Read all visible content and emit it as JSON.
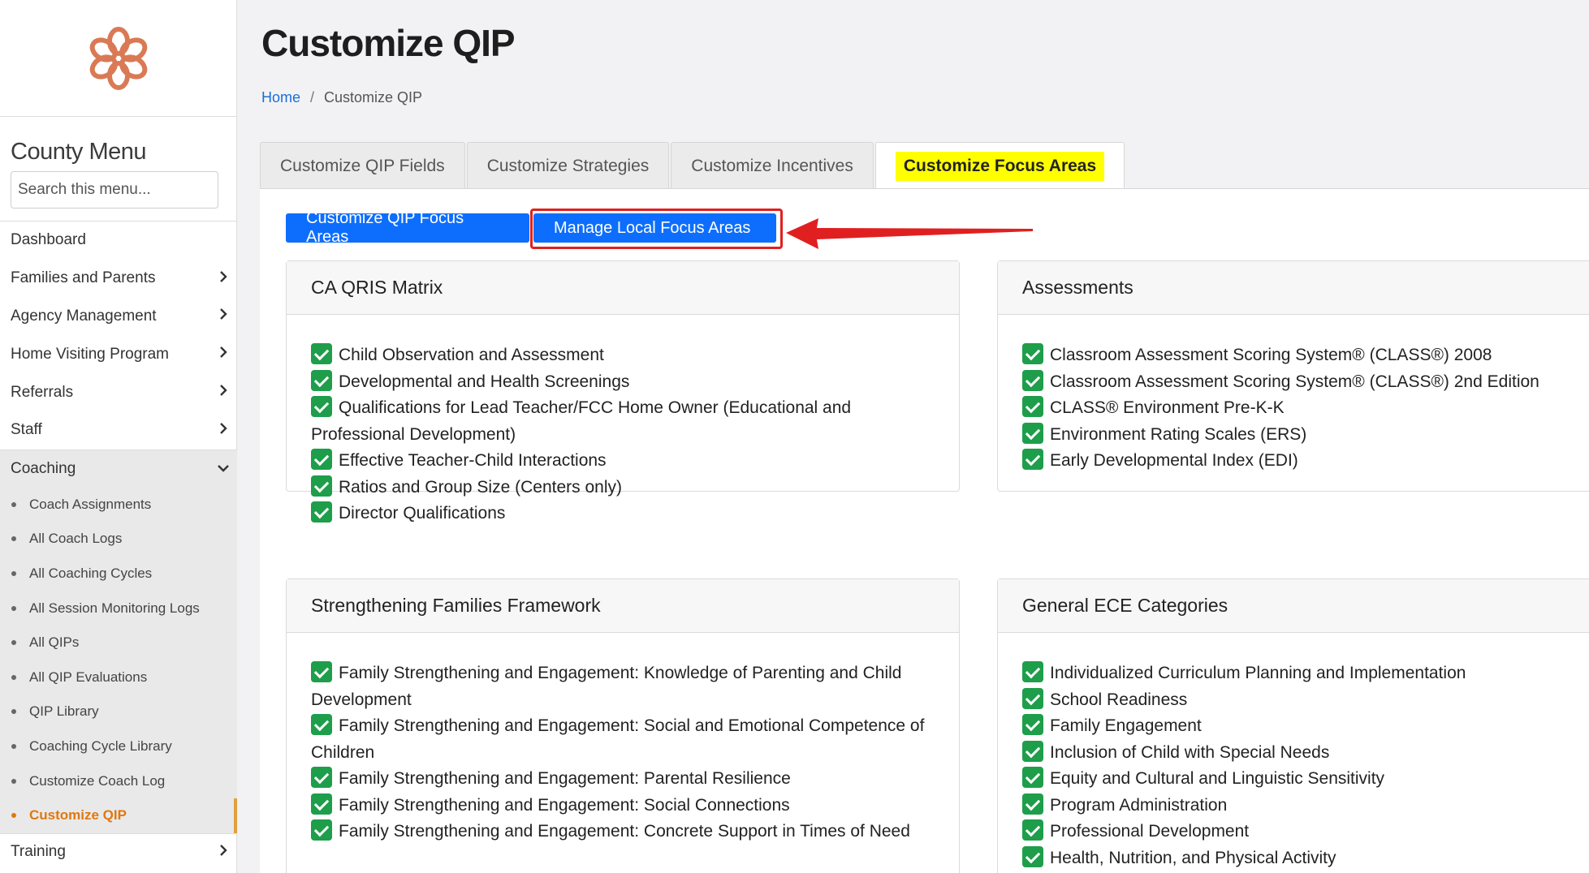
{
  "sidebar": {
    "menu_title": "County Menu",
    "search_placeholder": "Search this menu...",
    "items": [
      {
        "label": "Dashboard",
        "has_chevron": false
      },
      {
        "label": "Families and Parents",
        "has_chevron": true
      },
      {
        "label": "Agency Management",
        "has_chevron": true
      },
      {
        "label": "Home Visiting Program",
        "has_chevron": true
      },
      {
        "label": "Referrals",
        "has_chevron": true
      },
      {
        "label": "Staff",
        "has_chevron": true
      }
    ],
    "coaching": {
      "label": "Coaching",
      "subitems": [
        "Coach Assignments",
        "All Coach Logs",
        "All Coaching Cycles",
        "All Session Monitoring Logs",
        "All QIPs",
        "All QIP Evaluations",
        "QIP Library",
        "Coaching Cycle Library",
        "Customize Coach Log",
        "Customize QIP"
      ],
      "active_subitem": "Customize QIP"
    },
    "training": {
      "label": "Training"
    }
  },
  "header": {
    "title": "Customize QIP",
    "breadcrumb": {
      "home": "Home",
      "separator": "/",
      "current": "Customize QIP"
    }
  },
  "tabs": [
    {
      "label": "Customize QIP Fields",
      "active": false
    },
    {
      "label": "Customize Strategies",
      "active": false
    },
    {
      "label": "Customize Incentives",
      "active": false
    },
    {
      "label": "Customize Focus Areas",
      "active": true
    }
  ],
  "buttons": {
    "qip_focus_areas": "Customize QIP Focus Areas",
    "local_focus_areas": "Manage Local Focus Areas"
  },
  "cards": {
    "qris": {
      "title": "CA QRIS Matrix",
      "items": [
        "Child Observation and Assessment",
        "Developmental and Health Screenings",
        "Qualifications for Lead Teacher/FCC Home Owner (Educational and Professional Development)",
        "Effective Teacher-Child Interactions",
        "Ratios and Group Size (Centers only)",
        "Director Qualifications"
      ]
    },
    "assessments": {
      "title": "Assessments",
      "items": [
        "Classroom Assessment Scoring System® (CLASS®) 2008",
        "Classroom Assessment Scoring System® (CLASS®) 2nd Edition",
        "CLASS® Environment Pre-K-K",
        "Environment Rating Scales (ERS)",
        "Early Developmental Index (EDI)"
      ]
    },
    "families": {
      "title": "Strengthening Families Framework",
      "items": [
        "Family Strengthening and Engagement: Knowledge of Parenting and Child Development",
        "Family Strengthening and Engagement: Social and Emotional Competence of Children",
        "Family Strengthening and Engagement: Parental Resilience",
        "Family Strengthening and Engagement: Social Connections",
        "Family Strengthening and Engagement: Concrete Support in Times of Need"
      ]
    },
    "ece": {
      "title": "General ECE Categories",
      "items": [
        "Individualized Curriculum Planning and Implementation",
        "School Readiness",
        "Family Engagement",
        "Inclusion of Child with Special Needs",
        "Equity and Cultural and Linguistic Sensitivity",
        "Program Administration",
        "Professional Development",
        "Health, Nutrition, and Physical Activity"
      ]
    }
  },
  "colors": {
    "primary": "#0d6efd",
    "accent_orange": "#e0780f",
    "logo": "#d97a55",
    "check_green": "#1e9e4a",
    "highlight_yellow": "#ffff00",
    "annotation_red": "#e02020"
  },
  "icons": {
    "logo": "flower-logo-icon",
    "chevron_right": "chevron-right-icon",
    "chevron_down": "chevron-down-icon",
    "check": "checkbox-checked-icon",
    "annotation": "red-arrow-icon"
  }
}
